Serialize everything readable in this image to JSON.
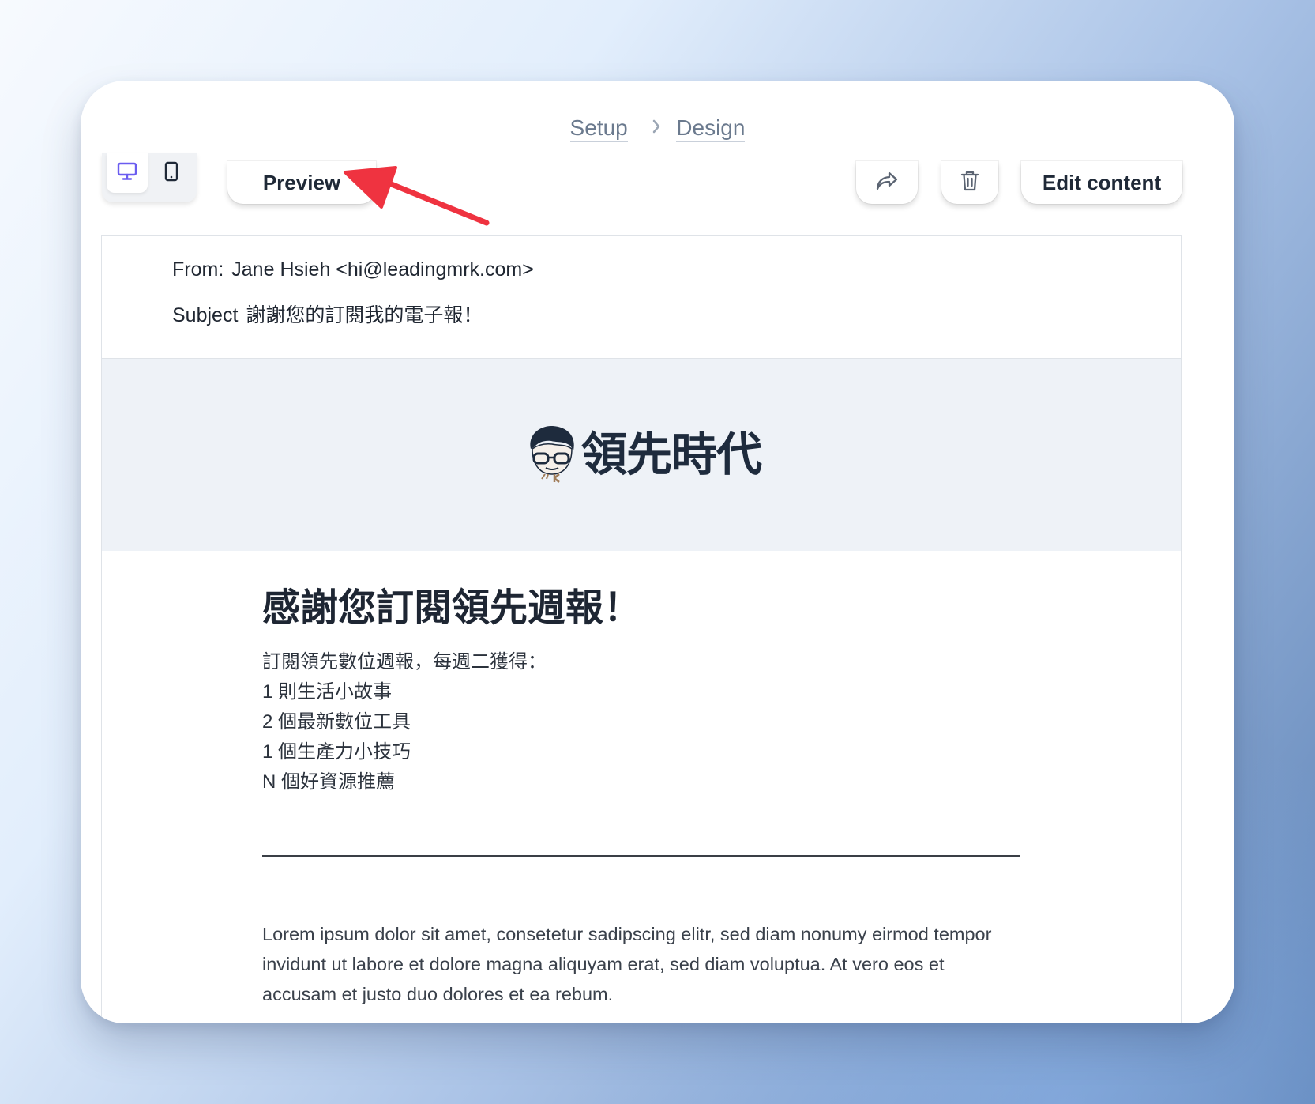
{
  "breadcrumb": {
    "step1": "Setup",
    "step2": "Design"
  },
  "toolbar": {
    "preview_label": "Preview",
    "edit_label": "Edit content",
    "icons": [
      "desktop-icon",
      "mobile-icon",
      "share-icon",
      "trash-icon"
    ]
  },
  "email": {
    "from_label": "From:",
    "from_value": "Jane Hsieh <hi@leadingmrk.com>",
    "subject_label": "Subject",
    "subject_value": "謝謝您的訂閱我的電子報！",
    "logo_text": "領先時代",
    "headline": "感謝您訂閱領先週報！",
    "intro_lines": [
      "訂閱領先數位週報，每週二獲得：",
      "1 則生活小故事",
      "2 個最新數位工具",
      "1 個生產力小技巧",
      "N 個好資源推薦"
    ],
    "lorem": "Lorem ipsum dolor sit amet, consetetur sadipscing elitr, sed diam nonumy eirmod tempor invidunt ut labore et dolore magna aliquyam erat, sed diam voluptua. At vero eos et accusam et justo duo dolores et ea rebum."
  },
  "colors": {
    "accent": "#6a5cf0",
    "arrow": "#ef3340",
    "banner_bg": "#eef2f7"
  }
}
